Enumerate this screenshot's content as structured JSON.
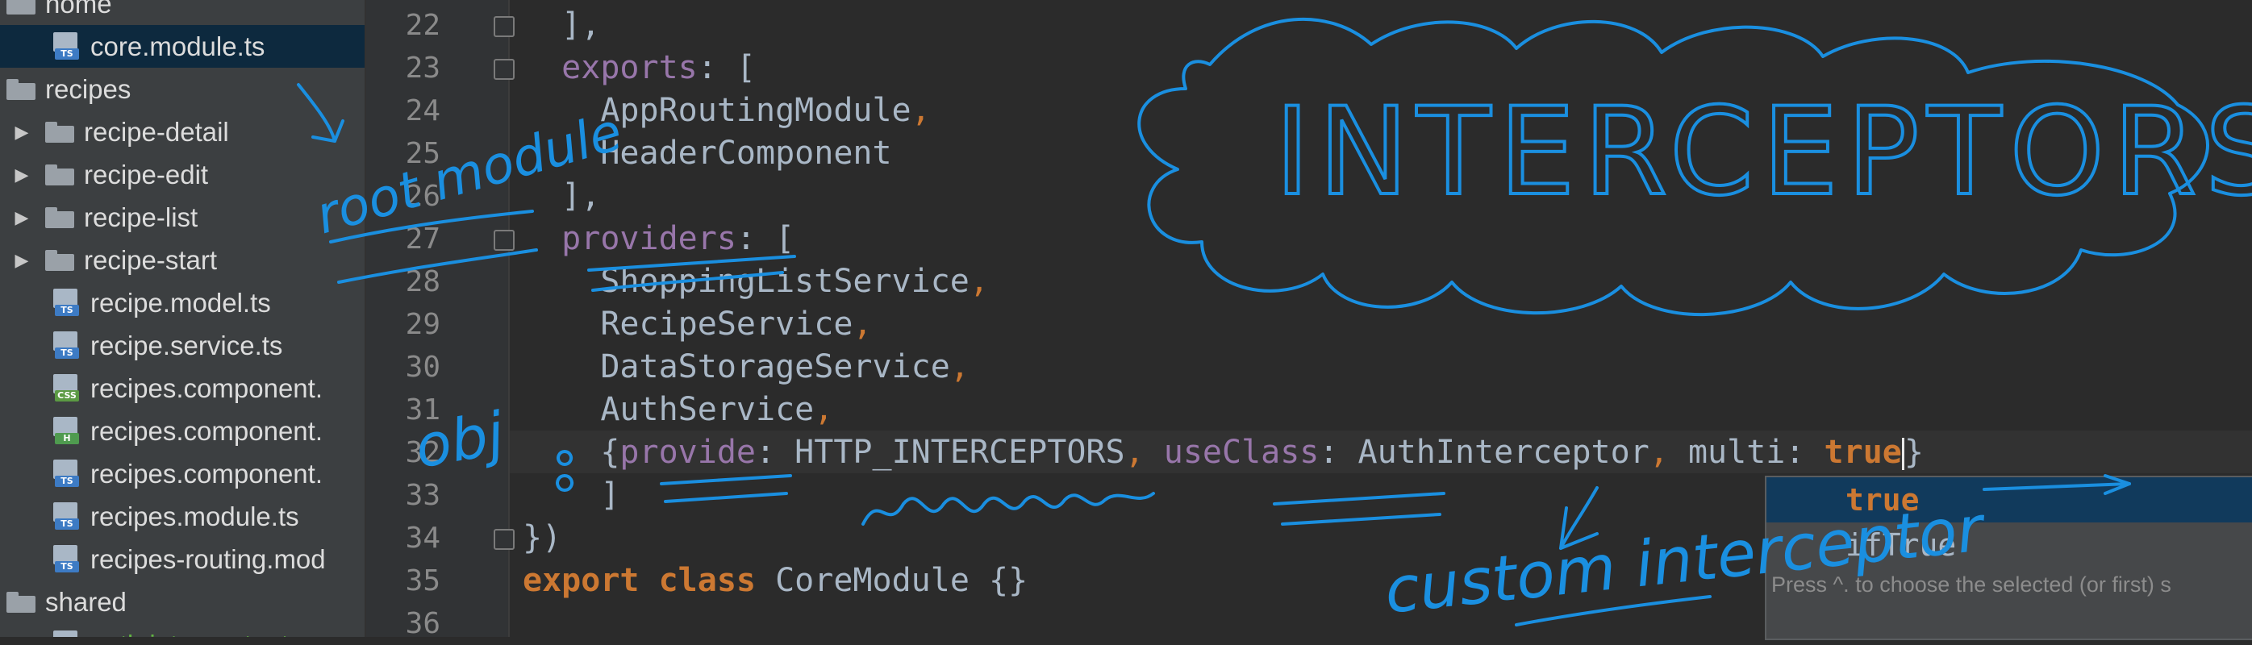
{
  "tree": {
    "items": [
      {
        "label": "home",
        "kind": "folder",
        "expander": ""
      },
      {
        "label": "core.module.ts",
        "kind": "file",
        "lang": "TS",
        "selected": true
      },
      {
        "label": "recipes",
        "kind": "folder",
        "expander": ""
      },
      {
        "label": "recipe-detail",
        "kind": "folder",
        "expander": "▶"
      },
      {
        "label": "recipe-edit",
        "kind": "folder",
        "expander": "▶"
      },
      {
        "label": "recipe-list",
        "kind": "folder",
        "expander": "▶"
      },
      {
        "label": "recipe-start",
        "kind": "folder",
        "expander": "▶"
      },
      {
        "label": "recipe.model.ts",
        "kind": "file",
        "lang": "TS"
      },
      {
        "label": "recipe.service.ts",
        "kind": "file",
        "lang": "TS"
      },
      {
        "label": "recipes.component.",
        "kind": "file",
        "lang": "CSS"
      },
      {
        "label": "recipes.component.",
        "kind": "file",
        "lang": "H"
      },
      {
        "label": "recipes.component.",
        "kind": "file",
        "lang": "TS"
      },
      {
        "label": "recipes.module.ts",
        "kind": "file",
        "lang": "TS"
      },
      {
        "label": "recipes-routing.mod",
        "kind": "file",
        "lang": "TS"
      },
      {
        "label": "shared",
        "kind": "folder",
        "expander": ""
      },
      {
        "label": "auth.interceptor.ts",
        "kind": "file",
        "lang": "TS",
        "green": true
      }
    ],
    "lang_colors": {
      "TS": "#3d7bc4",
      "CSS": "#5b9a43",
      "H": "#4f9b4f"
    }
  },
  "editor": {
    "line_numbers": [
      "22",
      "23",
      "24",
      "25",
      "26",
      "27",
      "28",
      "29",
      "30",
      "31",
      "32",
      "33",
      "34",
      "35",
      "36"
    ],
    "lines": [
      [
        {
          "t": "  ],",
          "c": "id"
        }
      ],
      [
        {
          "t": "  ",
          "c": "id"
        },
        {
          "t": "exports",
          "c": "pr"
        },
        {
          "t": ": [",
          "c": "id"
        }
      ],
      [
        {
          "t": "    AppRoutingModule",
          "c": "id"
        },
        {
          "t": ",",
          "c": "pn"
        }
      ],
      [
        {
          "t": "    HeaderComponent",
          "c": "id"
        }
      ],
      [
        {
          "t": "  ],",
          "c": "id"
        }
      ],
      [
        {
          "t": "  ",
          "c": "id"
        },
        {
          "t": "providers",
          "c": "pr"
        },
        {
          "t": ": [",
          "c": "id"
        }
      ],
      [
        {
          "t": "    ShoppingListService",
          "c": "id"
        },
        {
          "t": ",",
          "c": "pn"
        }
      ],
      [
        {
          "t": "    RecipeService",
          "c": "id"
        },
        {
          "t": ",",
          "c": "pn"
        }
      ],
      [
        {
          "t": "    DataStorageService",
          "c": "id"
        },
        {
          "t": ",",
          "c": "pn"
        }
      ],
      [
        {
          "t": "    AuthService",
          "c": "id"
        },
        {
          "t": ",",
          "c": "pn"
        }
      ],
      [
        {
          "t": "    {",
          "c": "id"
        },
        {
          "t": "provide",
          "c": "pr"
        },
        {
          "t": ": HTTP_INTERCEPTORS",
          "c": "id"
        },
        {
          "t": ", ",
          "c": "pn"
        },
        {
          "t": "useClass",
          "c": "pr"
        },
        {
          "t": ": AuthInterceptor",
          "c": "id"
        },
        {
          "t": ", ",
          "c": "pn"
        },
        {
          "t": "multi: ",
          "c": "id"
        },
        {
          "t": "true",
          "c": "kw"
        },
        {
          "t": "|",
          "c": "caret"
        },
        {
          "t": "}",
          "c": "id"
        }
      ],
      [
        {
          "t": "    ]",
          "c": "id"
        }
      ],
      [
        {
          "t": "})",
          "c": "id"
        }
      ],
      [
        {
          "t": "export class ",
          "c": "kw"
        },
        {
          "t": "CoreModule {}",
          "c": "id"
        }
      ],
      [
        {
          "t": "",
          "c": "id"
        }
      ]
    ]
  },
  "autocomplete": {
    "items": [
      {
        "text": "true",
        "bold": true,
        "selected": true
      },
      {
        "text": "ifTrue",
        "bold": false,
        "selected": false
      }
    ],
    "hint": "Press ^. to choose the selected (or first) s"
  },
  "annotations": {
    "title": "INTERCEPTORS",
    "note_left": "root module",
    "note_obj": "obj",
    "note_custom": "custom interceptor",
    "ink_color": "#1a8fe0"
  }
}
